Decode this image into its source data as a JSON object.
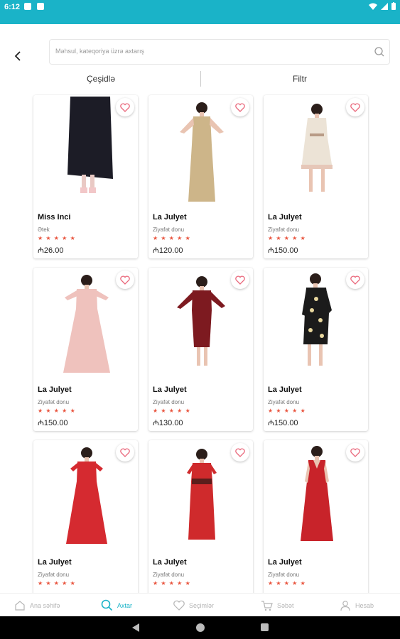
{
  "status_bar": {
    "time": "6:12"
  },
  "search": {
    "placeholder": "Məhsul, kateqoriya üzrə axtarış"
  },
  "toolbar": {
    "sort_label": "Çeşidlə",
    "filter_label": "Filtr"
  },
  "products": [
    {
      "brand": "Miss Inci",
      "category": "Ətek",
      "price": "₼26.00",
      "rating": 5,
      "dress_color": "#1c1c26",
      "image_icon": "black-skirt"
    },
    {
      "brand": "La Julyet",
      "category": "Ziyafət donu",
      "price": "₼120.00",
      "rating": 5,
      "dress_color": "#cdb589",
      "image_icon": "gold-gown"
    },
    {
      "brand": "La Julyet",
      "category": "Ziyafət donu",
      "price": "₼150.00",
      "rating": 5,
      "dress_color": "#ece3d6",
      "image_icon": "cream-dress"
    },
    {
      "brand": "La Julyet",
      "category": "Ziyafət donu",
      "price": "₼150.00",
      "rating": 5,
      "dress_color": "#efc2bd",
      "image_icon": "pink-gown"
    },
    {
      "brand": "La Julyet",
      "category": "Ziyafət donu",
      "price": "₼130.00",
      "rating": 5,
      "dress_color": "#7d1a20",
      "image_icon": "burgundy-lace-dress"
    },
    {
      "brand": "La Julyet",
      "category": "Ziyafət donu",
      "price": "₼150.00",
      "rating": 5,
      "dress_color": "#1b1b1b",
      "image_icon": "black-floral-dress"
    },
    {
      "brand": "La Julyet",
      "category": "Ziyafət donu",
      "price": "",
      "rating": 5,
      "dress_color": "#d52a30",
      "image_icon": "red-tulle-gown"
    },
    {
      "brand": "La Julyet",
      "category": "Ziyafət donu",
      "price": "",
      "rating": 5,
      "dress_color": "#cf2a2c",
      "image_icon": "red-gown"
    },
    {
      "brand": "La Julyet",
      "category": "Ziyafət donu",
      "price": "",
      "rating": 5,
      "dress_color": "#c8232a",
      "image_icon": "red-v-neck-gown"
    }
  ],
  "bottom_nav": [
    {
      "label": "Ana səhifə",
      "icon": "home-icon",
      "active": false
    },
    {
      "label": "Axtar",
      "icon": "search-icon",
      "active": true
    },
    {
      "label": "Seçimlər",
      "icon": "heart-icon",
      "active": false
    },
    {
      "label": "Səbət",
      "icon": "cart-icon",
      "active": false
    },
    {
      "label": "Hesab",
      "icon": "user-icon",
      "active": false
    }
  ],
  "colors": {
    "accent": "#1ab3c8",
    "star": "#e9553f",
    "favorite": "#e9667a"
  }
}
